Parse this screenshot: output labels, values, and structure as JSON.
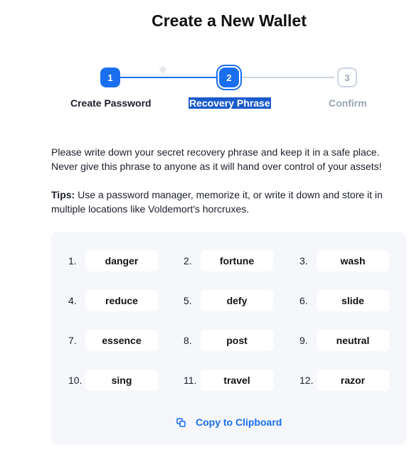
{
  "page": {
    "title": "Create a New Wallet"
  },
  "stepper": {
    "steps": [
      {
        "number": "1",
        "label": "Create Password",
        "state": "done"
      },
      {
        "number": "2",
        "label": "Recovery Phrase",
        "state": "current"
      },
      {
        "number": "3",
        "label": "Confirm",
        "state": "upcoming"
      }
    ]
  },
  "instructions": {
    "text": "Please write down your secret recovery phrase and keep it in a safe place. Never give this phrase to anyone as it will hand over control of your assets!",
    "tips_label": "Tips:",
    "tips_text": " Use a password manager, memorize it, or write it down and store it in multiple locations like Voldemort's horcruxes."
  },
  "phrase": {
    "words": [
      {
        "index": "1.",
        "word": "danger"
      },
      {
        "index": "2.",
        "word": "fortune"
      },
      {
        "index": "3.",
        "word": "wash"
      },
      {
        "index": "4.",
        "word": "reduce"
      },
      {
        "index": "5.",
        "word": "defy"
      },
      {
        "index": "6.",
        "word": "slide"
      },
      {
        "index": "7.",
        "word": "essence"
      },
      {
        "index": "8.",
        "word": "post"
      },
      {
        "index": "9.",
        "word": "neutral"
      },
      {
        "index": "10.",
        "word": "sing"
      },
      {
        "index": "11.",
        "word": "travel"
      },
      {
        "index": "12.",
        "word": "razor"
      }
    ],
    "copy_label": "Copy to Clipboard",
    "copy_icon": "copy-icon"
  },
  "colors": {
    "accent": "#1a6ff0",
    "muted": "#9aa4b2",
    "panel": "#f5f7fa"
  }
}
